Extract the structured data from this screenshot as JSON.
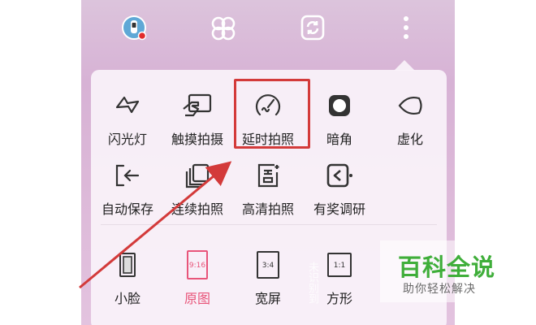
{
  "topbar": {
    "icons": [
      "avatar-icon",
      "beauty-filter-icon",
      "switch-camera-icon",
      "more-vert-icon"
    ]
  },
  "menu": {
    "row1": [
      {
        "icon": "flash-icon",
        "label": "闪光灯"
      },
      {
        "icon": "touch-shoot-icon",
        "label": "触摸拍摄"
      },
      {
        "icon": "timer-icon",
        "label": "延时拍照"
      },
      {
        "icon": "vignette-icon",
        "label": "暗角"
      },
      {
        "icon": "blur-icon",
        "label": "虚化"
      }
    ],
    "row2": [
      {
        "icon": "auto-save-icon",
        "label": "自动保存"
      },
      {
        "icon": "burst-shoot-icon",
        "label": "连续拍照"
      },
      {
        "icon": "hd-shoot-icon",
        "label": "高清拍照"
      },
      {
        "icon": "survey-icon",
        "label": "有奖调研"
      }
    ],
    "row3": [
      {
        "icon": "small-face-icon",
        "label": "小脸",
        "badge": ""
      },
      {
        "icon": "ratio-916-icon",
        "label": "原图",
        "badge": "9:16"
      },
      {
        "icon": "ratio-34-icon",
        "label": "宽屏",
        "badge": "3:4"
      },
      {
        "icon": "ratio-11-icon",
        "label": "方形",
        "badge": "1:1"
      }
    ],
    "selected_color": "#e8557a",
    "highlight_color": "#d33a3a"
  },
  "overlay_text": "未识别到",
  "watermark": {
    "logo": "百科全说",
    "subtitle": "助你轻松解决"
  }
}
